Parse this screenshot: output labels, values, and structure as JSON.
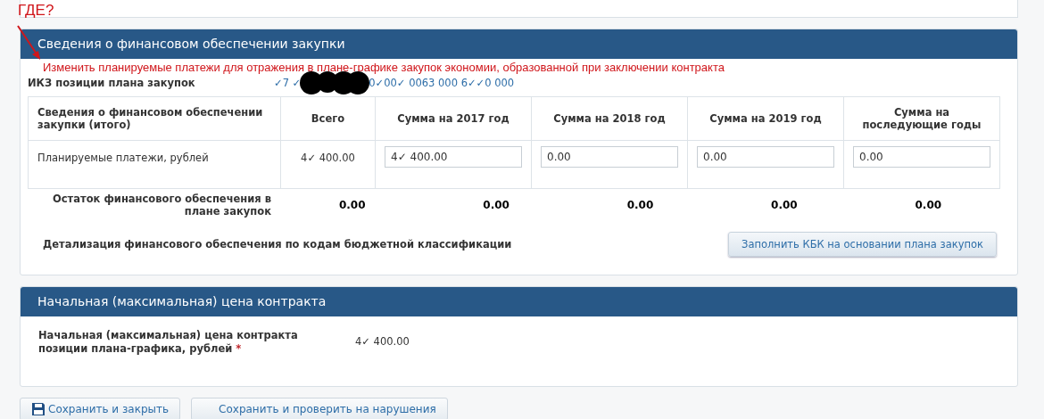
{
  "annotation": {
    "label": "ГДЕ?",
    "note": "Изменить планируемые платежи для отражения в плане-графике закупок экономии, образованной при заключении контракта"
  },
  "finance_section": {
    "title": "Сведения о финансовом обеспечении закупки",
    "ikz": {
      "label": "ИКЗ позиции плана закупок",
      "value_start": "✓7 ✓",
      "value_end": "0✓00✓ 0063 000 6✓✓0 000"
    },
    "table": {
      "columns": [
        "Сведения о финансовом обеспечении закупки (итого)",
        "Всего",
        "Сумма на 2017 год",
        "Сумма на 2018 год",
        "Сумма на 2019 год",
        "Сумма на последующие годы"
      ],
      "row": {
        "label": "Планируемые платежи, рублей",
        "total": "4✓ 400.00",
        "inputs": [
          "4✓ 400.00",
          "0.00",
          "0.00",
          "0.00"
        ]
      }
    },
    "remainder": {
      "label": "Остаток финансового обеспечения в плане закупок",
      "values": [
        "0.00",
        "0.00",
        "0.00",
        "0.00",
        "0.00"
      ]
    },
    "detail": {
      "label": "Детализация финансового обеспечения по кодам бюджетной классификации",
      "button": "Заполнить КБК на основании плана закупок"
    }
  },
  "price_section": {
    "title": "Начальная (максимальная) цена контракта",
    "label": "Начальная (максимальная) цена контракта позиции плана-графика, рублей",
    "required_mark": "*",
    "value": "4✓ 400.00"
  },
  "buttons": [
    {
      "label": "Сохранить и закрыть",
      "kind": "save"
    },
    {
      "label": "Сохранить и проверить на нарушения",
      "kind": "plain"
    }
  ]
}
